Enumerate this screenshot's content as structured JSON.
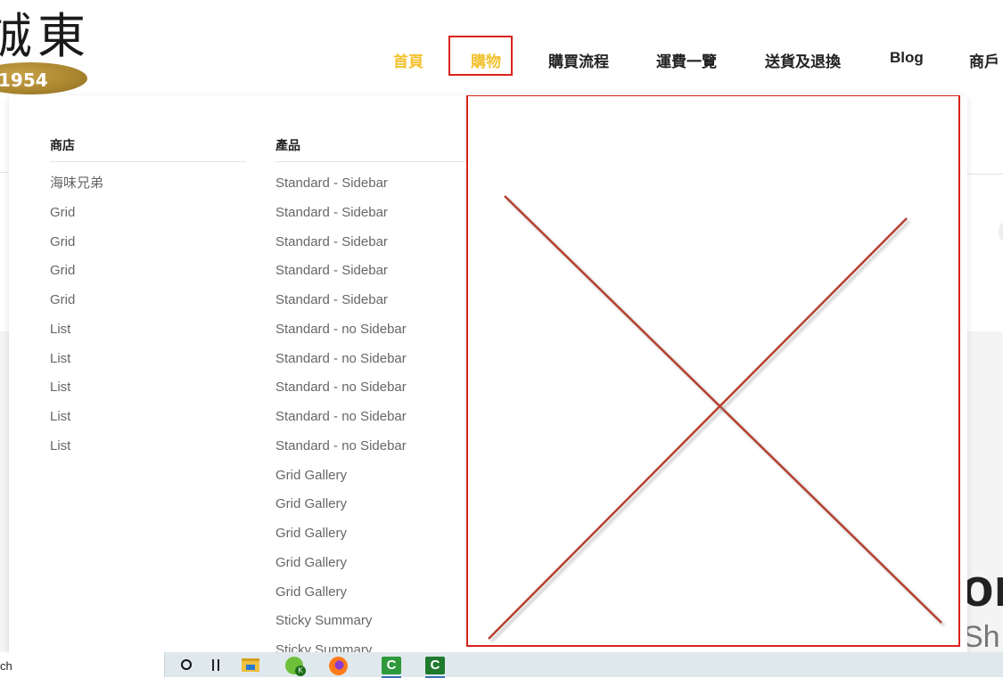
{
  "logo": {
    "chars": "誠東",
    "year": "1954"
  },
  "nav": {
    "items": [
      {
        "label": "首頁",
        "active": true
      },
      {
        "label": "購物",
        "active": true,
        "highlighted": true
      },
      {
        "label": "購買流程",
        "active": false
      },
      {
        "label": "運費一覽",
        "active": false
      },
      {
        "label": "送貨及退換",
        "active": false
      },
      {
        "label": "Blog",
        "active": false
      },
      {
        "label": "商戶",
        "active": false
      }
    ]
  },
  "mega_menu": {
    "shop": {
      "heading": "商店",
      "items": [
        "海味兄弟",
        "Grid",
        "Grid",
        "Grid",
        "Grid",
        "List",
        "List",
        "List",
        "List",
        "List"
      ]
    },
    "products": {
      "heading": "產品",
      "items": [
        "Standard - Sidebar",
        "Standard - Sidebar",
        "Standard - Sidebar",
        "Standard - Sidebar",
        "Standard - Sidebar",
        "Standard - no Sidebar",
        "Standard - no Sidebar",
        "Standard - no Sidebar",
        "Standard - no Sidebar",
        "Standard - no Sidebar",
        "Grid Gallery",
        "Grid Gallery",
        "Grid Gallery",
        "Grid Gallery",
        "Grid Gallery",
        "Sticky Summary",
        "Sticky Summary"
      ]
    }
  },
  "background": {
    "big_text": "on",
    "sub_text": "Sh"
  },
  "taskbar": {
    "search_text": "ch",
    "apple_badge": "K",
    "app_letter": "C"
  },
  "colors": {
    "accent": "#f2c12e",
    "highlight_border": "#d9221c",
    "placeholder_line": "#b5402f"
  }
}
